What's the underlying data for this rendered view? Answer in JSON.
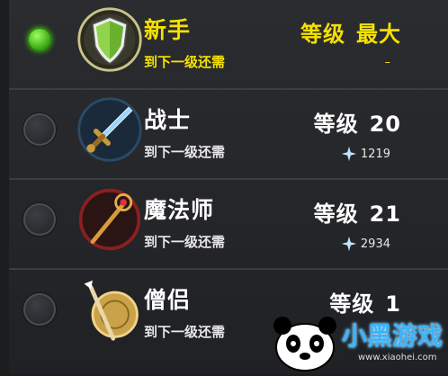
{
  "classes": [
    {
      "name": "新手",
      "sub_label": "到下一级还需",
      "level_label": "等级",
      "level_value": "最大",
      "need_value": "–",
      "selected": true,
      "icon": "shield-icon"
    },
    {
      "name": "战士",
      "sub_label": "到下一级还需",
      "level_label": "等级",
      "level_value": "20",
      "need_value": "1219",
      "selected": false,
      "icon": "sword-icon"
    },
    {
      "name": "魔法师",
      "sub_label": "到下一级还需",
      "level_label": "等级",
      "level_value": "21",
      "need_value": "2934",
      "selected": false,
      "icon": "staff-icon"
    },
    {
      "name": "僧侣",
      "sub_label": "到下一级还需",
      "level_label": "等级",
      "level_value": "1",
      "need_value": "",
      "selected": false,
      "icon": "monk-staff-icon"
    }
  ],
  "watermark": {
    "text": "小黑游戏",
    "url": "www.xiaohei.com"
  },
  "colors": {
    "highlight": "#f5e100",
    "selected_radio": "#3aa615",
    "background": "#1f2124"
  }
}
